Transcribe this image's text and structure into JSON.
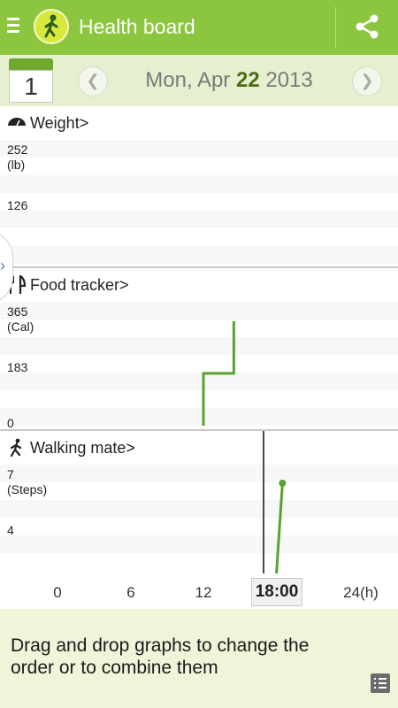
{
  "app": {
    "title": "Health board",
    "icons": [
      "menu-icon",
      "walking-figure-logo",
      "share-icon"
    ]
  },
  "date_bar": {
    "calendar_day": "1",
    "date_prefix": "Mon, Apr",
    "date_day": "22",
    "date_year": "2013",
    "prev_icon": "chevron-left-icon",
    "next_icon": "chevron-right-icon"
  },
  "panels": {
    "weight": {
      "title": "Weight",
      "suffix": ">",
      "y_top_label": "252",
      "y_unit": "(lb)",
      "y_mid_label": "126"
    },
    "food": {
      "title": "Food tracker",
      "suffix": ">",
      "y_top_label": "365",
      "y_unit": "(Cal)",
      "y_mid_label": "183",
      "y_zero_label": "0"
    },
    "walking": {
      "title": "Walking mate",
      "suffix": ">",
      "y_top_label": "7",
      "y_unit": "(Steps)",
      "y_mid_label": "4"
    }
  },
  "x_axis": {
    "labels": [
      "0",
      "6",
      "12",
      "18:00",
      "24(h)"
    ],
    "selected": "18:00"
  },
  "footer": {
    "hint": "Drag and drop graphs to change the order or to combine them"
  },
  "colors": {
    "accent": "#8cc63f",
    "line": "#5aa131",
    "date_bar": "#e6f0d0",
    "footer": "#eef5d9"
  },
  "chart_data": [
    {
      "type": "line",
      "title": "Food tracker",
      "ylabel": "(Cal)",
      "ylim": [
        0,
        365
      ],
      "x": [
        12,
        12,
        14.5,
        14.5
      ],
      "series": [
        {
          "values": [
            0,
            183,
            183,
            365
          ]
        }
      ]
    },
    {
      "type": "line",
      "title": "Walking mate",
      "ylabel": "(Steps)",
      "ylim": [
        0,
        7
      ],
      "x": [
        18,
        18.5
      ],
      "series": [
        {
          "values": [
            0,
            7
          ]
        }
      ]
    }
  ]
}
